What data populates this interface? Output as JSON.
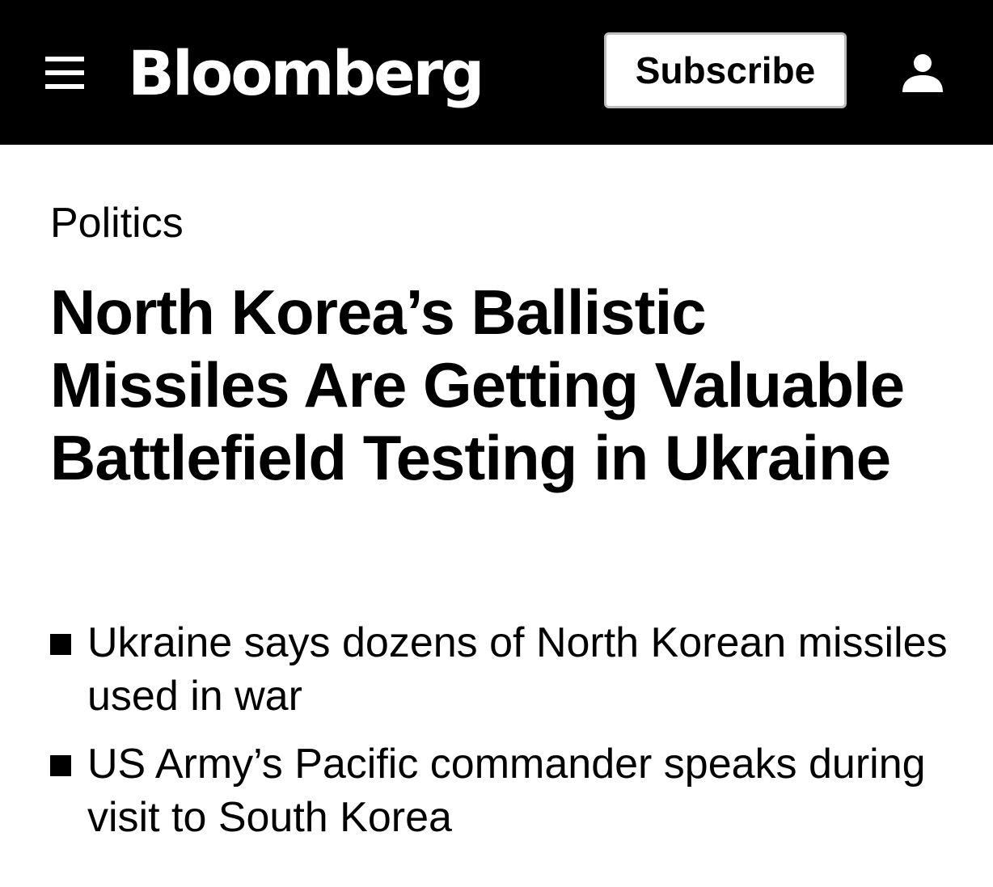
{
  "header": {
    "menu_icon": "hamburger-menu-icon",
    "logo_text": "Bloomberg",
    "subscribe_label": "Subscribe",
    "account_icon": "user-icon",
    "background_color": "#000000",
    "foreground_color": "#ffffff"
  },
  "article": {
    "category": "Politics",
    "headline": "North Korea’s Ballistic Missiles Are Getting Valuable Battlefield Testing in Ukraine",
    "bullets": [
      {
        "text": "Ukraine says dozens of North Korean missiles used in war"
      },
      {
        "text": "US Army’s Pacific commander speaks during visit to South Korea"
      }
    ]
  }
}
